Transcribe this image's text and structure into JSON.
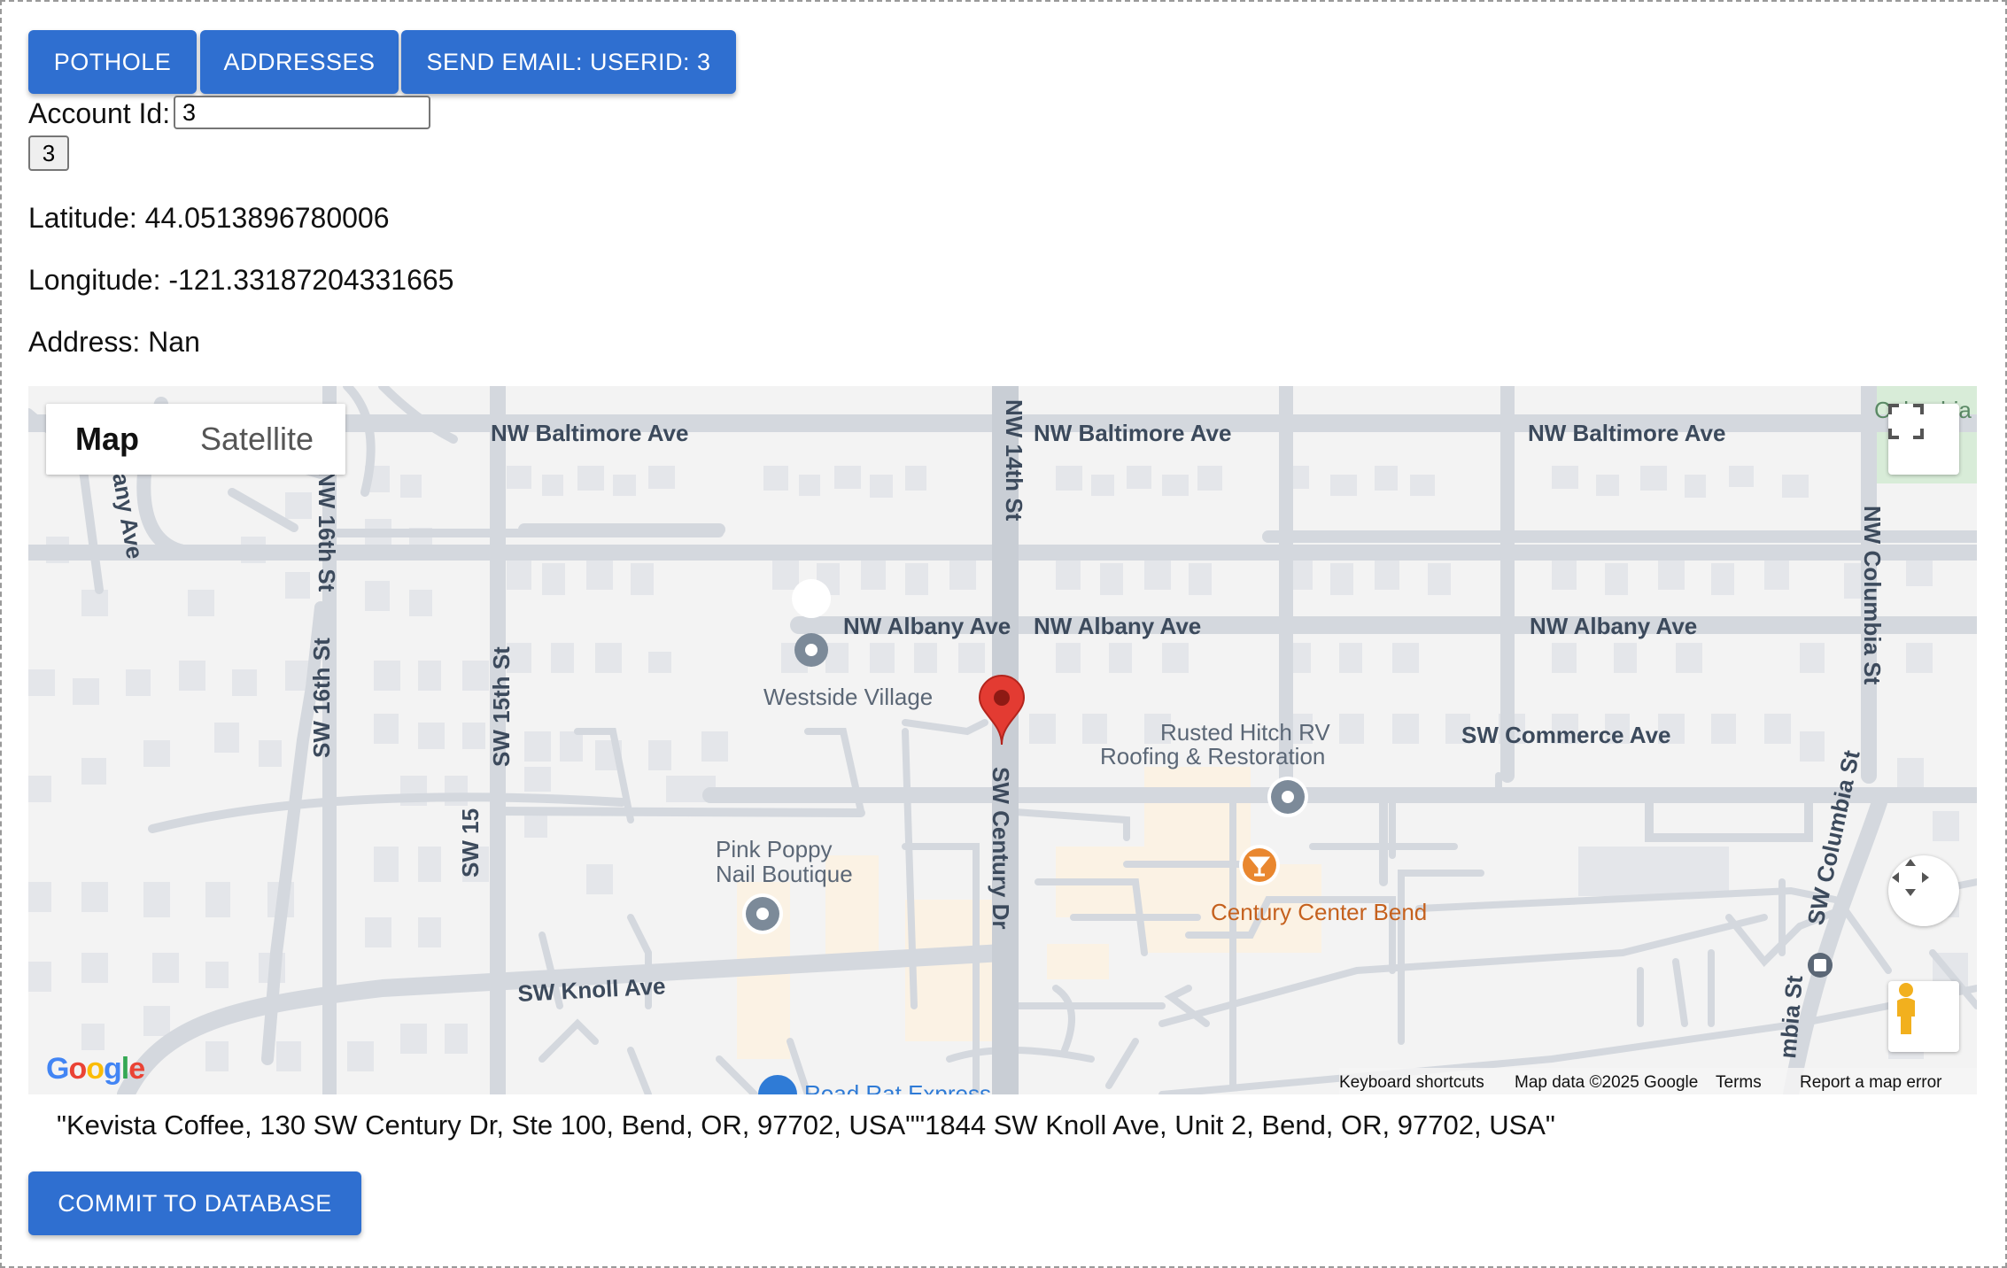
{
  "toolbar": {
    "pothole_label": "POTHOLE",
    "addresses_label": "ADDRESSES",
    "send_email_label": "SEND EMAIL: USERID: 3"
  },
  "account": {
    "label": "Account Id:",
    "value": "3",
    "button_label": "3"
  },
  "info": {
    "latitude": "Latitude: 44.0513896780006",
    "longitude": "Longitude: -121.33187204331665",
    "address": "Address: Nan"
  },
  "map": {
    "type_map_label": "Map",
    "type_satellite_label": "Satellite",
    "google_logo": "Google",
    "footer": {
      "shortcuts": "Keyboard shortcuts",
      "map_data": "Map data ©2025 Google",
      "terms": "Terms",
      "report": "Report a map error"
    },
    "roads": {
      "baltimore_1": "NW Baltimore Ave",
      "baltimore_2": "NW Baltimore Ave",
      "baltimore_3": "NW Baltimore Ave",
      "albany_1": "NW Albany Ave",
      "albany_2": "NW Albany Ave",
      "albany_3": "NW Albany Ave",
      "commerce": "SW Commerce Ave",
      "knoll": "SW Knoll Ave",
      "nw14": "NW 14th St",
      "nw16": "NW 16th St",
      "sw15": "SW 15th St",
      "sw16": "SW 16th St",
      "sw15b": "SW 15",
      "century": "SW Century Dr",
      "nwcolumbia": "NW Columbia St",
      "swcolumbia": "SW Columbia St",
      "albany_left": "any Ave",
      "columbia_left": "mbia St"
    },
    "places": {
      "westside": "Westside Village",
      "rusted1": "Rusted Hitch RV",
      "rusted2": "Roofing & Restoration",
      "pink1": "Pink Poppy",
      "pink2": "Nail Boutique",
      "century_center": "Century Center Bend",
      "road_rat": "Road Rat Express",
      "columbia_park": "Columbia"
    },
    "colors": {
      "marker": "#e33b32",
      "poi_gray": "#7c8a99",
      "poi_orange": "#e9872f",
      "century_center_text": "#c5611e"
    }
  },
  "addresses_text": "\"Kevista Coffee, 130 SW Century Dr, Ste 100, Bend, OR, 97702, USA\"\"1844 SW Knoll Ave, Unit 2, Bend, OR, 97702, USA\"",
  "commit_label": "COMMIT TO DATABASE",
  "colors": {
    "primary": "#2f6fd0"
  }
}
